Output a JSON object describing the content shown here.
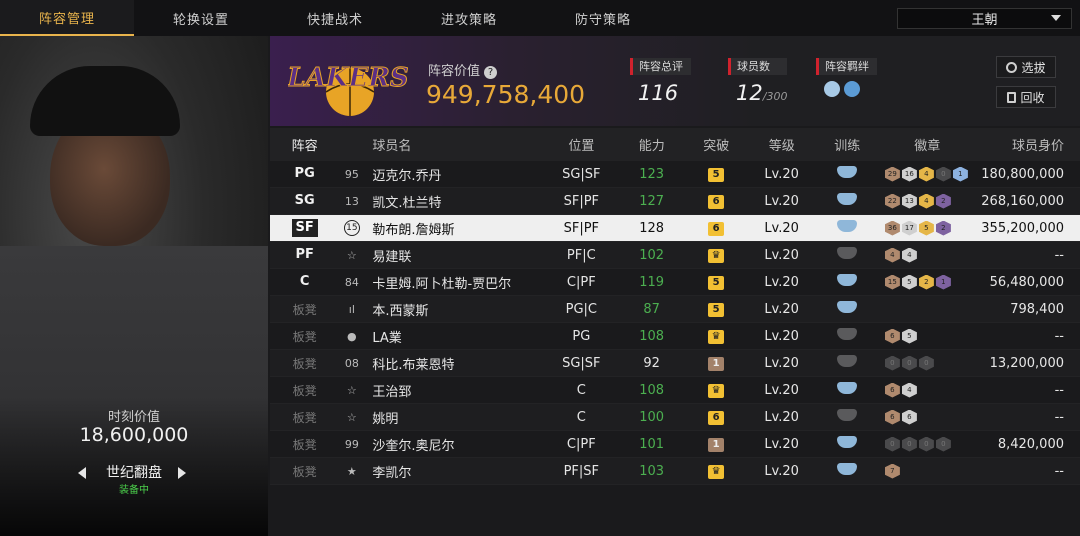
{
  "nav": {
    "tabs": [
      "阵容管理",
      "轮换设置",
      "快捷战术",
      "进攻策略",
      "防守策略"
    ],
    "active_tab": 0,
    "team_select": "王朝"
  },
  "left_panel": {
    "value_label": "时刻价值",
    "value": "18,600,000",
    "set_name": "世纪翻盘",
    "set_status": "装备中"
  },
  "header": {
    "logo_text": "LAKERS",
    "lineup_value_label": "阵容价值",
    "lineup_value": "949,758,400",
    "rating_label": "阵容总评",
    "rating_value": "116",
    "players_label": "球员数",
    "players_value": "12",
    "players_max": "/300",
    "bond_label": "阵容羁绊",
    "btn_select": "选拔",
    "btn_recycle": "回收"
  },
  "table": {
    "headers": [
      "阵容",
      "球员名",
      "位置",
      "能力",
      "突破",
      "等级",
      "训练",
      "徽章",
      "球员身价"
    ],
    "rows": [
      {
        "pos": "PG",
        "num": "95",
        "name": "迈克尔.乔丹",
        "role": "SG|SF",
        "ovr": "123",
        "brk": "5",
        "lvl": "Lv.20",
        "badges": [
          "29",
          "16",
          "4",
          "0",
          "1"
        ],
        "value": "180,800,000"
      },
      {
        "pos": "SG",
        "num": "13",
        "name": "凯文.杜兰特",
        "role": "SF|PF",
        "ovr": "127",
        "brk": "6",
        "lvl": "Lv.20",
        "badges": [
          "22",
          "13",
          "4",
          "2"
        ],
        "value": "268,160,000"
      },
      {
        "pos": "SF",
        "num": "15",
        "name": "勒布朗.詹姆斯",
        "role": "SF|PF",
        "ovr": "128",
        "brk": "6",
        "lvl": "Lv.20",
        "badges": [
          "36",
          "17",
          "5",
          "2"
        ],
        "value": "355,200,000"
      },
      {
        "pos": "PF",
        "num": "☆",
        "name": "易建联",
        "role": "PF|C",
        "ovr": "102",
        "brk": "♛",
        "lvl": "Lv.20",
        "badges": [
          "4",
          "4"
        ],
        "value": "--"
      },
      {
        "pos": "C",
        "num": "84",
        "name": "卡里姆.阿卜杜勒-贾巴尔",
        "role": "C|PF",
        "ovr": "119",
        "brk": "5",
        "lvl": "Lv.20",
        "badges": [
          "15",
          "5",
          "2",
          "1"
        ],
        "value": "56,480,000"
      },
      {
        "pos": "板凳",
        "num": "ıl",
        "name": "本.西蒙斯",
        "role": "PG|C",
        "ovr": "87",
        "brk": "5",
        "lvl": "Lv.20",
        "badges": [],
        "value": "798,400"
      },
      {
        "pos": "板凳",
        "num": "●",
        "name": "LA業",
        "role": "PG",
        "ovr": "108",
        "brk": "♛",
        "lvl": "Lv.20",
        "badges": [
          "6",
          "5"
        ],
        "value": "--"
      },
      {
        "pos": "板凳",
        "num": "08",
        "name": "科比.布莱恩特",
        "role": "SG|SF",
        "ovr": "92",
        "brk": "1",
        "lvl": "Lv.20",
        "badges": [
          "0",
          "0",
          "0"
        ],
        "value": "13,200,000"
      },
      {
        "pos": "板凳",
        "num": "☆",
        "name": "王治郅",
        "role": "C",
        "ovr": "108",
        "brk": "♛",
        "lvl": "Lv.20",
        "badges": [
          "6",
          "4"
        ],
        "value": "--"
      },
      {
        "pos": "板凳",
        "num": "☆",
        "name": "姚明",
        "role": "C",
        "ovr": "100",
        "brk": "6",
        "lvl": "Lv.20",
        "badges": [
          "6",
          "6"
        ],
        "value": "--"
      },
      {
        "pos": "板凳",
        "num": "99",
        "name": "沙奎尔.奥尼尔",
        "role": "C|PF",
        "ovr": "101",
        "brk": "1",
        "lvl": "Lv.20",
        "badges": [
          "0",
          "0",
          "0",
          "0"
        ],
        "value": "8,420,000"
      },
      {
        "pos": "板凳",
        "num": "★",
        "name": "李凯尔",
        "role": "PF|SF",
        "ovr": "103",
        "brk": "♛",
        "lvl": "Lv.20",
        "badges": [
          "7"
        ],
        "value": "--"
      }
    ]
  },
  "colors": {
    "accent_gold": "#e9b44c",
    "ovr_green": "#4caf50",
    "stat_red": "#d0222d",
    "lakers_purple": "#3a1f4e"
  }
}
